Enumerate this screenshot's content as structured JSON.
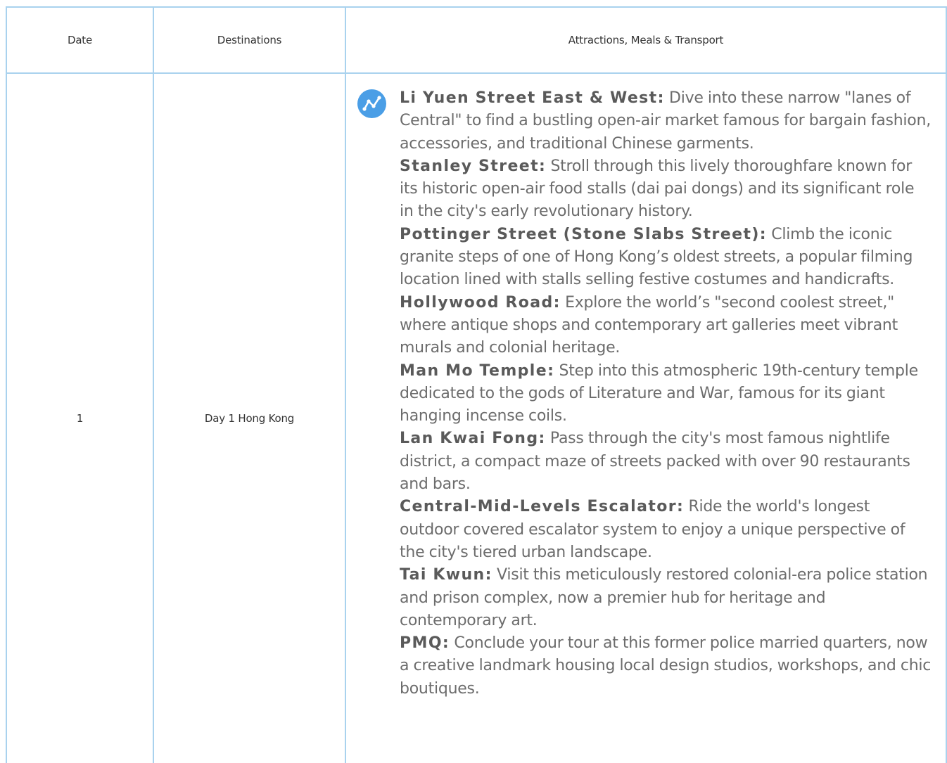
{
  "table": {
    "headers": {
      "date": "Date",
      "destinations": "Destinations",
      "attractions": "Attractions, Meals & Transport"
    },
    "row": {
      "date": "1",
      "destination": "Day 1 Hong Kong",
      "route_icon": "route-icon",
      "attractions": [
        {
          "name": "Li Yuen Street East & West:",
          "desc": " Dive into these narrow \"lanes of Central\" to find a bustling open-air market famous for bargain fashion, accessories, and traditional Chinese garments."
        },
        {
          "name": "Stanley Street:",
          "desc": " Stroll through this lively thoroughfare known for its historic open-air food stalls (dai pai dongs) and its significant role in the city's early revolutionary history."
        },
        {
          "name": "Pottinger Street (Stone Slabs Street):",
          "desc": " Climb the iconic granite steps of one of Hong Kong’s oldest streets, a popular filming location lined with stalls selling festive costumes and handicrafts."
        },
        {
          "name": "Hollywood Road:",
          "desc": " Explore the world’s \"second coolest street,\" where antique shops and contemporary art galleries meet vibrant murals and colonial heritage."
        },
        {
          "name": "Man Mo Temple:",
          "desc": " Step into this atmospheric 19th-century temple dedicated to the gods of Literature and War, famous for its giant hanging incense coils."
        },
        {
          "name": "Lan Kwai Fong:",
          "desc": " Pass through the city's most famous nightlife district, a compact maze of streets packed with over 90 restaurants and bars."
        },
        {
          "name": "Central-Mid-Levels Escalator:",
          "desc": " Ride the world's longest outdoor covered escalator system to enjoy a unique perspective of the city's tiered urban landscape."
        },
        {
          "name": "Tai Kwun:",
          "desc": " Visit this meticulously restored colonial-era police station and prison complex, now a premier hub for heritage and contemporary art."
        },
        {
          "name": "PMQ:",
          "desc": " Conclude your tour at this former police married quarters, now a creative landmark housing local design studios, workshops, and chic boutiques."
        }
      ]
    }
  },
  "colors": {
    "border": "#a9d2ee",
    "icon_bg": "#4a9ee6",
    "text": "#6c6c6c"
  }
}
